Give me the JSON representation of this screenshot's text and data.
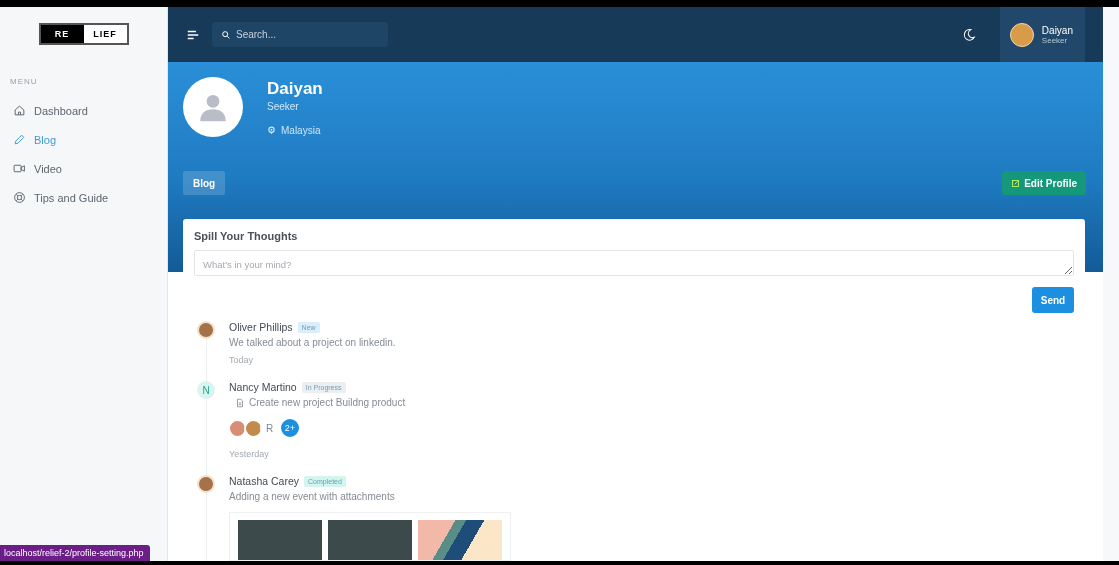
{
  "sidebar": {
    "logo": {
      "left": "RE",
      "right": "LIEF"
    },
    "section_title": "MENU",
    "items": [
      {
        "label": "Dashboard",
        "selected": false
      },
      {
        "label": "Blog",
        "selected": true
      },
      {
        "label": "Video",
        "selected": false
      },
      {
        "label": "Tips and Guide",
        "selected": false
      }
    ]
  },
  "header": {
    "search": {
      "placeholder": "Search..."
    },
    "user": {
      "name": "Daiyan",
      "role": "Seeker"
    }
  },
  "profile": {
    "name": "Daiyan",
    "role": "Seeker",
    "location": "Malaysia",
    "tab": "Blog",
    "edit_button": "Edit Profile"
  },
  "composer": {
    "title": "Spill Your Thoughts",
    "placeholder": "What's in your mind?",
    "send_button": "Send"
  },
  "feed": [
    {
      "avatar": {
        "kind": "photo"
      },
      "name": "Oliver Phillips",
      "badge": "New",
      "color": "#dcedfb",
      "text": "We talked about a project on linkedin.",
      "time": "Today"
    },
    {
      "avatar": {
        "kind": "letter",
        "text": "N"
      },
      "name": "Nancy Martino",
      "badge": "In Progress",
      "color": "#eceef1",
      "text": "Create new project Buildng product",
      "attached_file": true,
      "participants": [
        {
          "kind": "photo"
        },
        {
          "kind": "photo"
        },
        {
          "kind": "letter",
          "text": "R"
        },
        {
          "kind": "count",
          "text": "2+"
        }
      ],
      "time": "Yesterday"
    },
    {
      "avatar": {
        "kind": "photo"
      },
      "name": "Natasha Carey",
      "badge": "Completed",
      "color": "#d4f4ee",
      "text": "Adding a new event with attachments",
      "attachments": [
        {
          "kind": "photo"
        },
        {
          "kind": "photo"
        },
        {
          "kind": "graphic"
        }
      ]
    }
  ],
  "status_link": "localhost/relief-2/profile-setting.php"
}
